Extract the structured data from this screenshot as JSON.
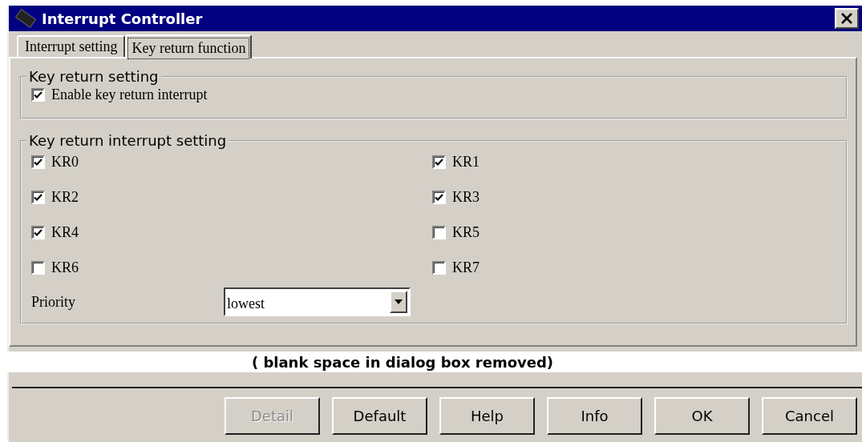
{
  "window": {
    "title": "Interrupt Controller"
  },
  "tabs": [
    {
      "label": "Interrupt setting",
      "selected": false
    },
    {
      "label": "Key return function",
      "selected": true
    }
  ],
  "key_return_setting": {
    "legend": "Key return setting",
    "checkbox": {
      "label": "Enable key return interrupt",
      "checked": true
    }
  },
  "key_return_interrupt_setting": {
    "legend": "Key return interrupt setting",
    "checkboxes": [
      {
        "label": "KR0",
        "checked": true
      },
      {
        "label": "KR1",
        "checked": true
      },
      {
        "label": "KR2",
        "checked": true
      },
      {
        "label": "KR3",
        "checked": true
      },
      {
        "label": "KR4",
        "checked": true
      },
      {
        "label": "KR5",
        "checked": false
      },
      {
        "label": "KR6",
        "checked": false
      },
      {
        "label": "KR7",
        "checked": false
      }
    ],
    "priority": {
      "label": "Priority",
      "value": "lowest"
    }
  },
  "note": "( blank space in dialog box removed)",
  "buttons": [
    {
      "label": "Detail",
      "disabled": true
    },
    {
      "label": "Default",
      "disabled": false
    },
    {
      "label": "Help",
      "disabled": false
    },
    {
      "label": "Info",
      "disabled": false
    },
    {
      "label": "OK",
      "disabled": false
    },
    {
      "label": "Cancel",
      "disabled": false
    }
  ]
}
